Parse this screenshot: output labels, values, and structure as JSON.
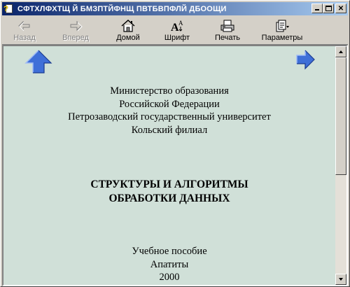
{
  "window": {
    "title": "СФТХЛФХТЩ Й БМЗПТЙФНЩ ПВТБВПФЛЙ ДБООЩИ"
  },
  "toolbar": {
    "back": {
      "label": "Назад",
      "icon": "back-arrow-icon",
      "enabled": false
    },
    "forward": {
      "label": "Вперед",
      "icon": "forward-arrow-icon",
      "enabled": false
    },
    "home": {
      "label": "Домой",
      "icon": "home-icon"
    },
    "font": {
      "label": "Шрифт",
      "icon": "font-size-icon"
    },
    "print": {
      "label": "Печать",
      "icon": "printer-icon"
    },
    "options": {
      "label": "Параметры",
      "icon": "options-icon"
    }
  },
  "document": {
    "org_lines": [
      "Министерство образования",
      "Российской Федерации",
      "Петрозаводский государственный университет",
      "Кольский филиал"
    ],
    "title_lines": [
      "СТРУКТУРЫ И АЛГОРИТМЫ",
      "ОБРАБОТКИ ДАННЫХ"
    ],
    "imprint_lines": [
      "Учебное пособие",
      "Апатиты",
      "2000"
    ]
  },
  "colors": {
    "content_background": "#d0e0d8",
    "title_bar_start": "#0a246a",
    "title_bar_end": "#a6caf0",
    "nav_arrow": "#3f6fd8"
  }
}
